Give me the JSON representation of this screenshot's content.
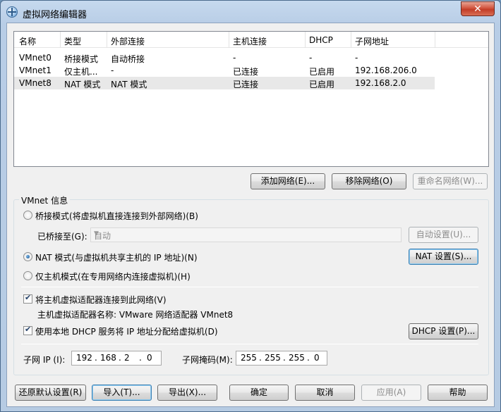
{
  "window": {
    "title": "虚拟网络编辑器",
    "close_label": "✕"
  },
  "network_table": {
    "headers": [
      "名称",
      "类型",
      "外部连接",
      "主机连接",
      "DHCP",
      "子网地址"
    ],
    "rows": [
      [
        "VMnet0",
        "桥接模式",
        "自动桥接",
        "-",
        "-",
        "-"
      ],
      [
        "VMnet1",
        "仅主机...",
        "-",
        "已连接",
        "已启用",
        "192.168.206.0"
      ],
      [
        "VMnet8",
        "NAT 模式",
        "NAT 模式",
        "已连接",
        "已启用",
        "192.168.2.0"
      ]
    ],
    "selected_row": 2
  },
  "network_buttons": {
    "add": "添加网络(E)...",
    "remove": "移除网络(O)",
    "rename": "重命名网络(W)..."
  },
  "vmnet_info": {
    "group_label": "VMnet 信息",
    "bridged": {
      "label": "桥接模式(将虚拟机直接连接到外部网络)(B)",
      "checked": false
    },
    "bridged_to": {
      "label": "已桥接至(G):",
      "value": "自动",
      "auto_settings": "自动设置(U)..."
    },
    "nat": {
      "label": "NAT 模式(与虚拟机共享主机的 IP 地址)(N)",
      "checked": true,
      "settings_button": "NAT 设置(S)..."
    },
    "host_only": {
      "label": "仅主机模式(在专用网络内连接虚拟机)(H)",
      "checked": false
    },
    "connect_adapter": {
      "label": "将主机虚拟适配器连接到此网络(V)",
      "checked": true
    },
    "adapter_name": "主机虚拟适配器名称: VMware 网络适配器 VMnet8",
    "use_dhcp": {
      "label": "使用本地 DHCP 服务将 IP 地址分配给虚拟机(D)",
      "checked": true,
      "settings_button": "DHCP 设置(P)..."
    },
    "subnet_ip": {
      "label": "子网 IP (I):",
      "octets": [
        "192",
        "168",
        "2",
        "0"
      ]
    },
    "subnet_mask": {
      "label": "子网掩码(M):",
      "octets": [
        "255",
        "255",
        "255",
        "0"
      ]
    }
  },
  "footer_buttons": {
    "restore": "还原默认设置(R)",
    "import": "导入(T)...",
    "export": "导出(X)...",
    "ok": "确定",
    "cancel": "取消",
    "apply": "应用(A)",
    "help": "帮助"
  },
  "colors": {
    "title_bar": "#c6d9ee",
    "close_button": "#c23d27",
    "selection": "#e8e8e8",
    "focus_border": "#3c7fb1"
  }
}
